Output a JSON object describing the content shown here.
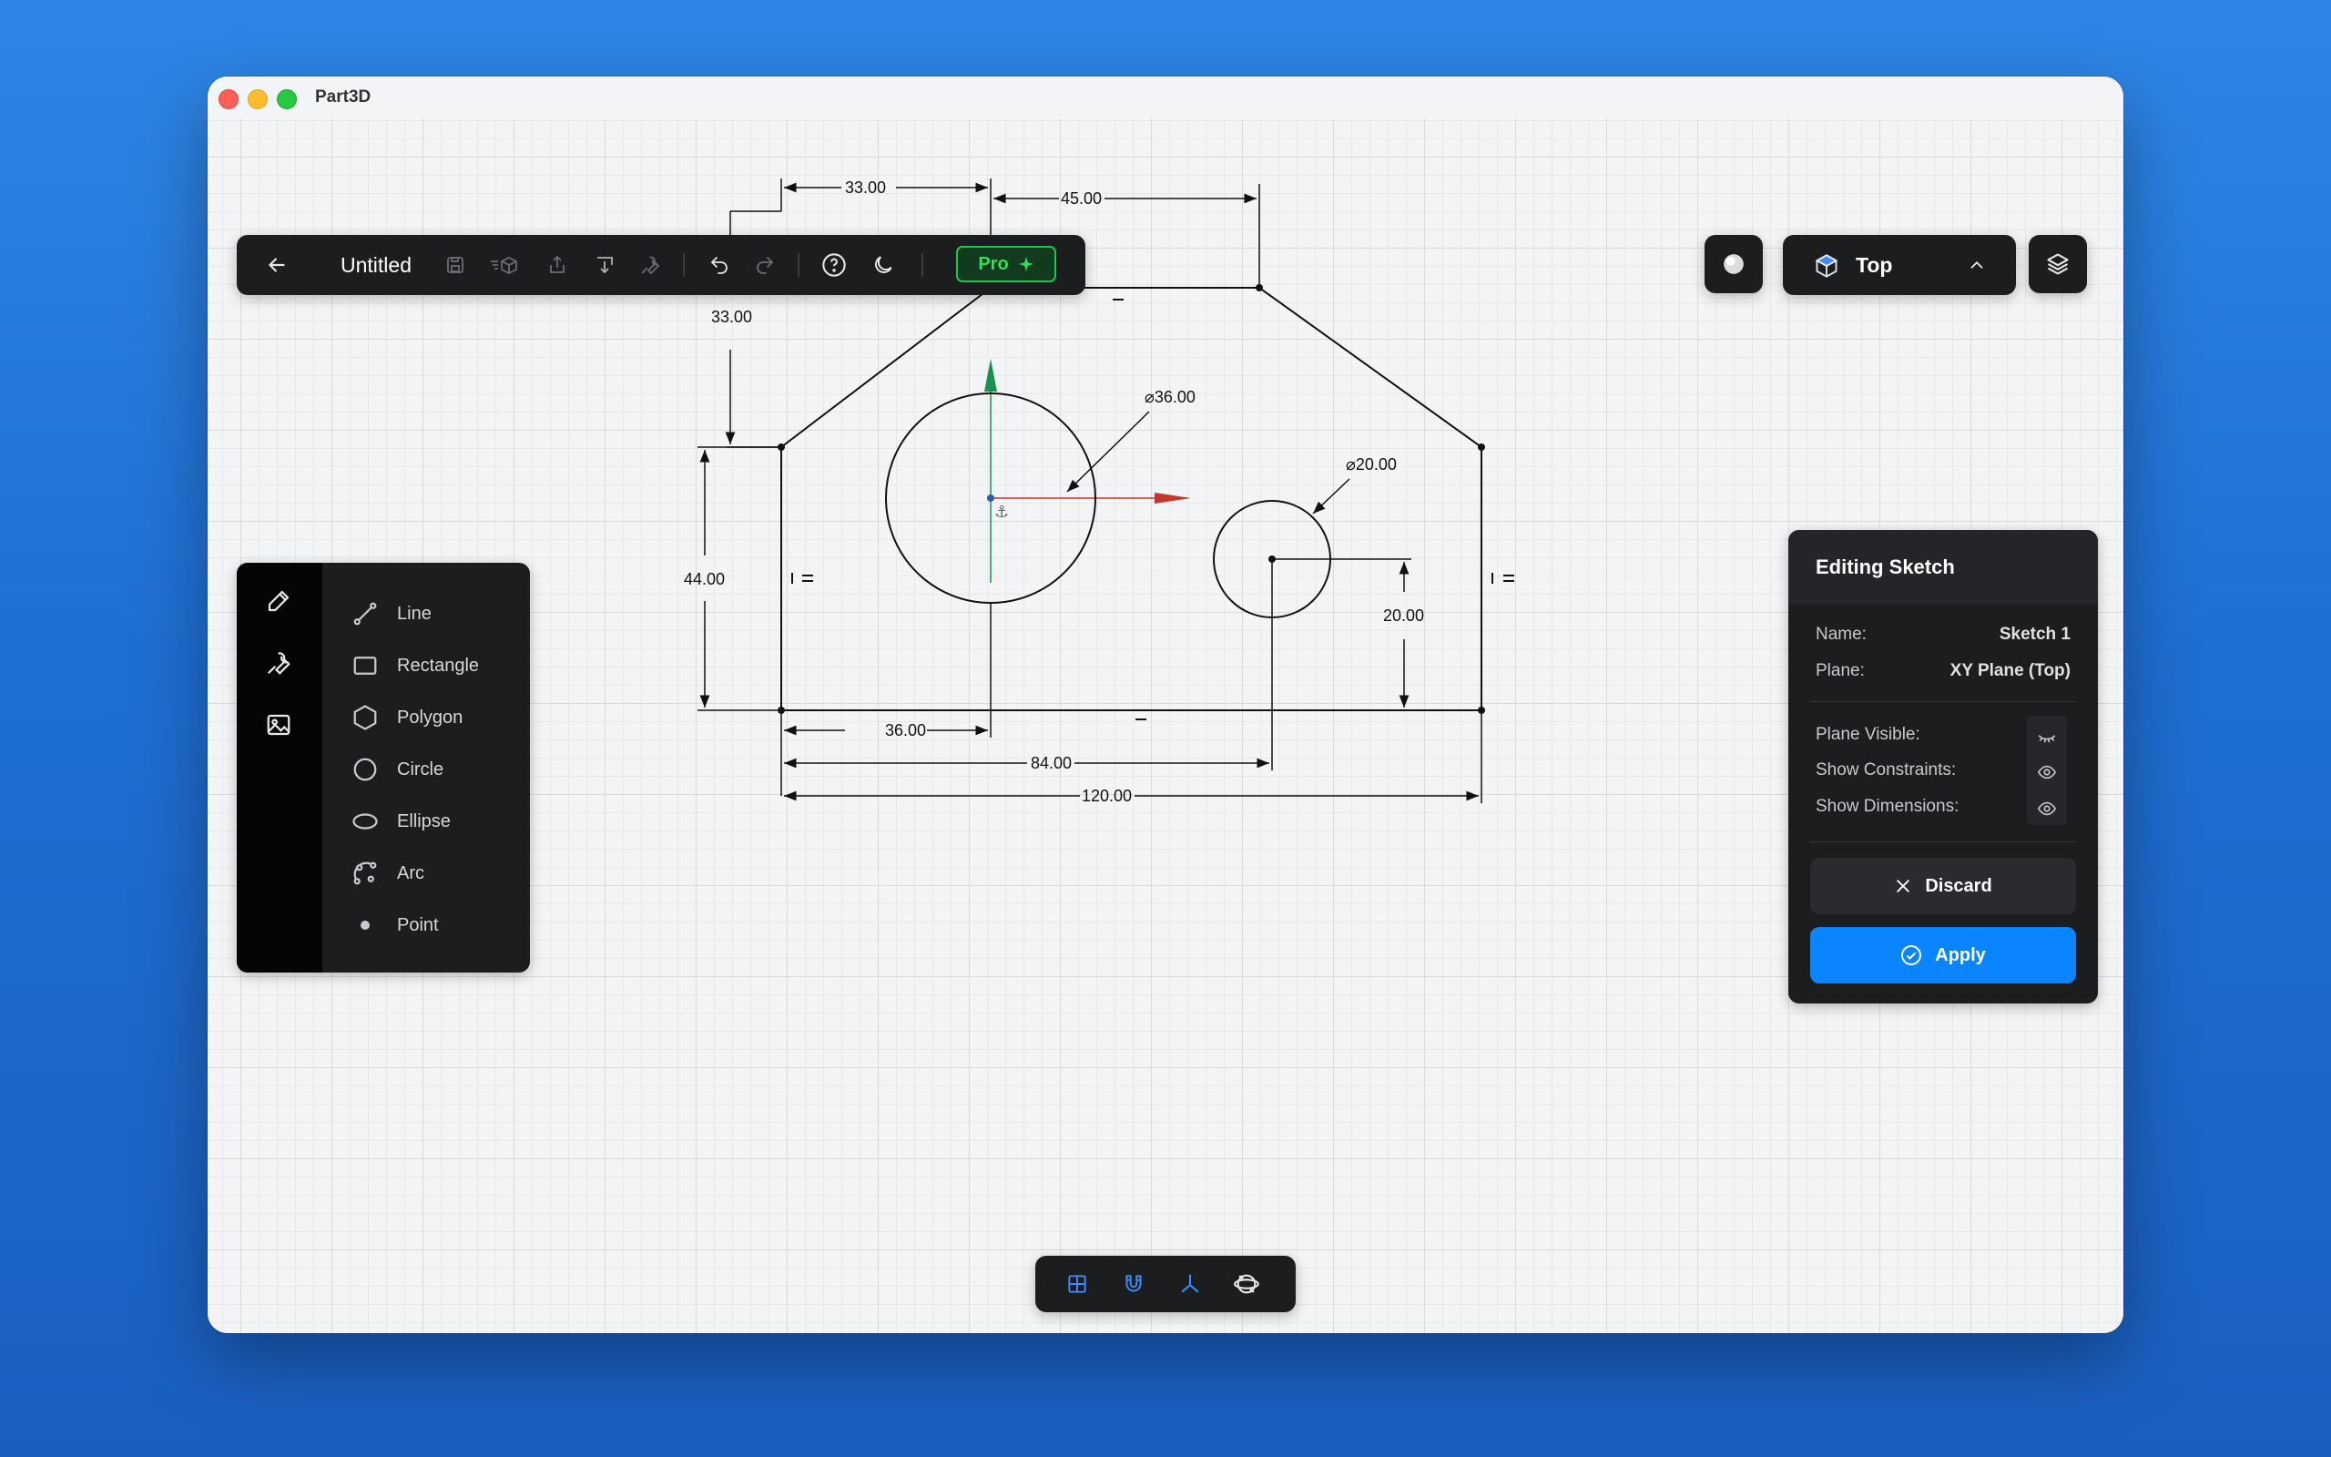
{
  "window": {
    "app_title": "Part3D"
  },
  "toolbar": {
    "document_title": "Untitled",
    "pro_label": "Pro"
  },
  "view": {
    "current": "Top"
  },
  "tools": {
    "items": [
      {
        "label": "Line",
        "icon": "line-icon"
      },
      {
        "label": "Rectangle",
        "icon": "rectangle-icon"
      },
      {
        "label": "Polygon",
        "icon": "polygon-icon"
      },
      {
        "label": "Circle",
        "icon": "circle-icon"
      },
      {
        "label": "Ellipse",
        "icon": "ellipse-icon"
      },
      {
        "label": "Arc",
        "icon": "arc-icon"
      },
      {
        "label": "Point",
        "icon": "point-icon"
      }
    ]
  },
  "editing_sketch": {
    "title": "Editing Sketch",
    "name_label": "Name:",
    "name_value": "Sketch 1",
    "plane_label": "Plane:",
    "plane_value": "XY Plane (Top)",
    "plane_visible_label": "Plane Visible:",
    "show_constraints_label": "Show Constraints:",
    "show_dimensions_label": "Show Dimensions:",
    "discard_label": "Discard",
    "apply_label": "Apply"
  },
  "dimensions": {
    "d_33_top": "33.00",
    "d_45": "45.00",
    "d_33_left": "33.00",
    "d_44": "44.00",
    "d_36": "36.00",
    "d_84": "84.00",
    "d_120": "120.00",
    "d_20": "20.00",
    "dia_36": "⌀36.00",
    "dia_20": "⌀20.00"
  },
  "colors": {
    "accent": "#0a84ff",
    "pro_green": "#1fc84a",
    "axis_x": "#c0392b",
    "axis_y": "#1e8e4e"
  }
}
